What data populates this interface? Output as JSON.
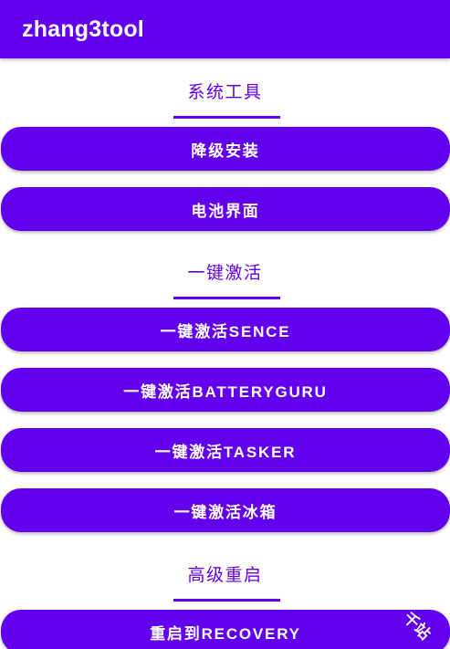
{
  "app": {
    "title": "zhang3tool"
  },
  "sections": [
    {
      "title": "系统工具",
      "buttons": [
        "降级安装",
        "电池界面"
      ]
    },
    {
      "title": "一键激活",
      "buttons": [
        "一键激活SENCE",
        "一键激活BATTERYGURU",
        "一键激活TASKER",
        "一键激活冰箱"
      ]
    },
    {
      "title": "高级重启",
      "buttons": [
        "重启到RECOVERY"
      ]
    }
  ],
  "watermark": "千站",
  "colors": {
    "primary": "#6200ee",
    "on_primary": "#ffffff",
    "background": "#ffffff"
  }
}
